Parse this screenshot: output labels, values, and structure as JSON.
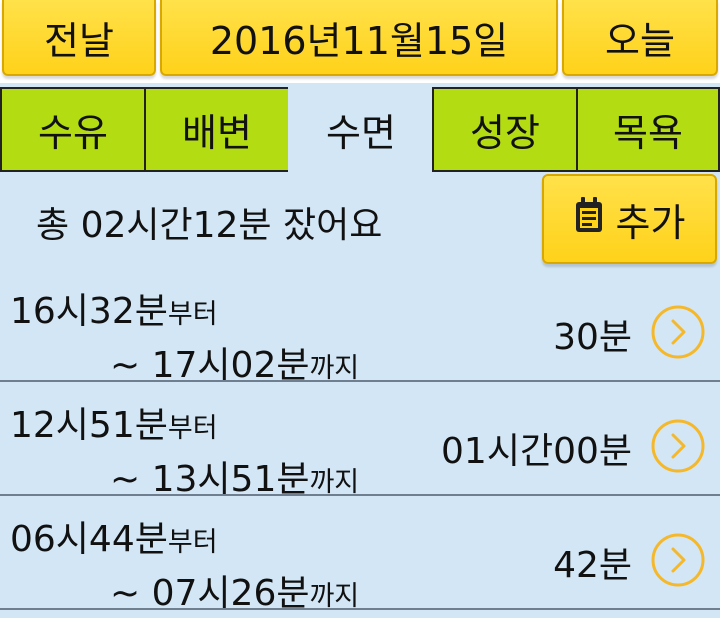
{
  "header": {
    "prev_label": "전날",
    "date_label": "2016년11월15일",
    "today_label": "오늘"
  },
  "tabs": [
    {
      "label": "수유"
    },
    {
      "label": "배변"
    },
    {
      "label": "수면"
    },
    {
      "label": "성장"
    },
    {
      "label": "목욕"
    }
  ],
  "active_tab": 2,
  "summary": {
    "text": "총 02시간12분 잤어요",
    "add_label": "추가",
    "add_icon": "notepad-icon"
  },
  "entries": [
    {
      "from_time": "16시32분",
      "from_suffix": "부터",
      "to_time": "~ 17시02분",
      "to_suffix": "까지",
      "duration": "30분"
    },
    {
      "from_time": "12시51분",
      "from_suffix": "부터",
      "to_time": "~ 13시51분",
      "to_suffix": "까지",
      "duration": "01시간00분"
    },
    {
      "from_time": "06시44분",
      "from_suffix": "부터",
      "to_time": "~ 07시26분",
      "to_suffix": "까지",
      "duration": "42분"
    }
  ],
  "colors": {
    "yellow_button": "#ffd21a",
    "tab_green": "#b3dc12",
    "background_blue": "#d3e6f5",
    "chevron_orange": "#f5b82a"
  }
}
